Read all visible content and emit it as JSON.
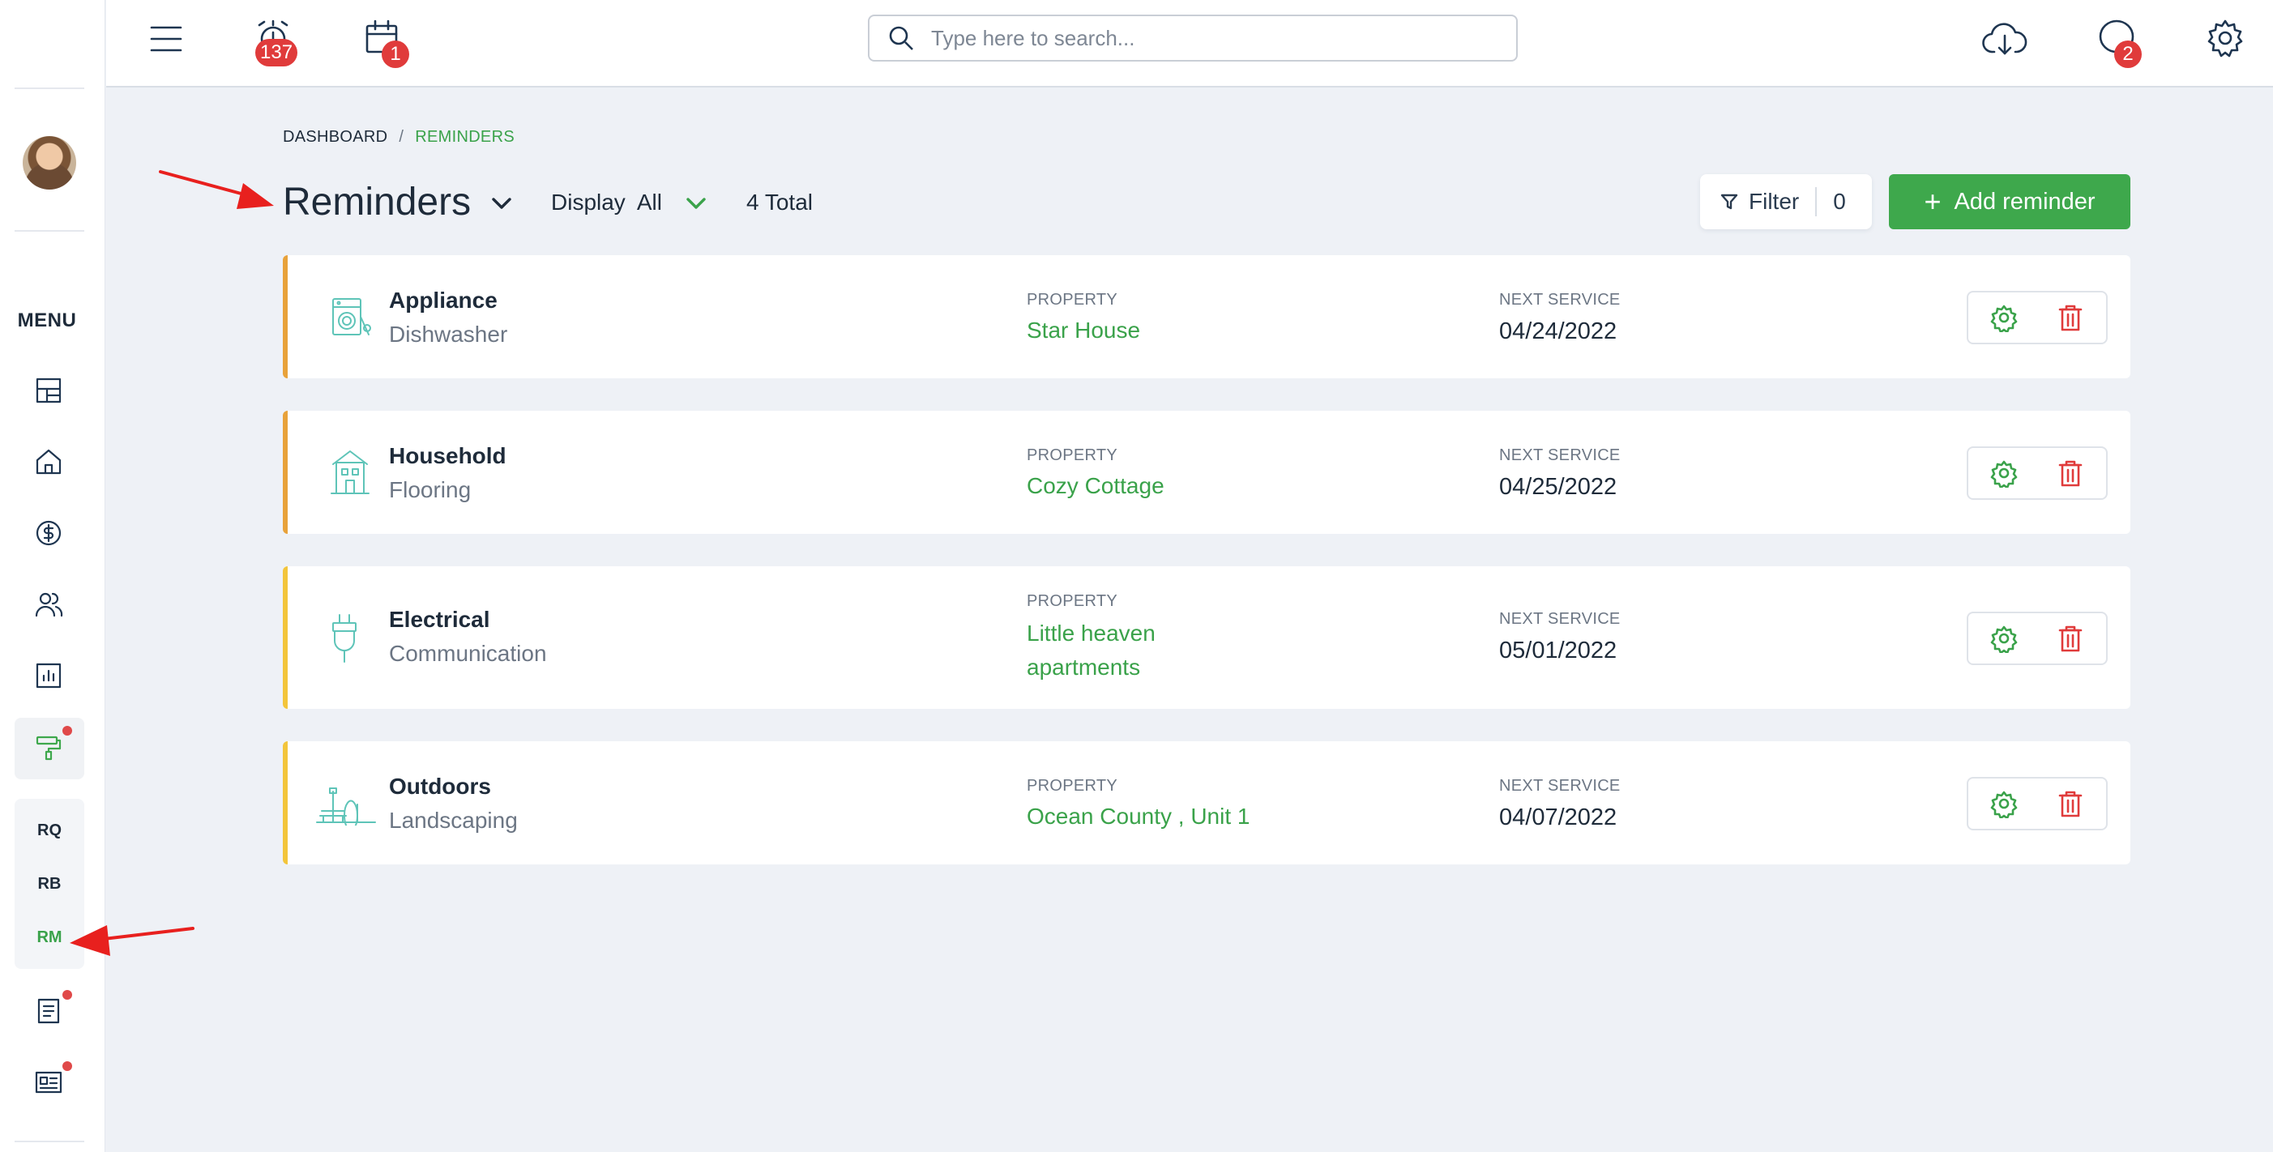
{
  "sidebar": {
    "menu_title": "MENU",
    "sub_items": [
      "RQ",
      "RB",
      "RM"
    ]
  },
  "topbar": {
    "alarm_badge": "137",
    "calendar_badge": "1",
    "chat_badge": "2",
    "search_placeholder": "Type here to search..."
  },
  "breadcrumb": {
    "root": "DASHBOARD",
    "separator": "/",
    "current": "REMINDERS"
  },
  "header": {
    "title": "Reminders",
    "display_label": "Display",
    "display_value": "All",
    "total": "4 Total",
    "filter_label": "Filter",
    "filter_count": "0",
    "add_label": "Add reminder"
  },
  "labels": {
    "property": "PROPERTY",
    "next_service": "NEXT SERVICE"
  },
  "reminders": [
    {
      "category": "Appliance",
      "subcategory": "Dishwasher",
      "property": "Star House",
      "next_service": "04/24/2022",
      "icon": "washing-machine-icon",
      "accent": "#e8a23a"
    },
    {
      "category": "Household",
      "subcategory": "Flooring",
      "property": "Cozy Cottage",
      "next_service": "04/25/2022",
      "icon": "house-icon",
      "accent": "#e8a23a"
    },
    {
      "category": "Electrical",
      "subcategory": "Communication",
      "property": "Little heaven apartments",
      "next_service": "05/01/2022",
      "icon": "plug-icon",
      "accent": "#f3c53b"
    },
    {
      "category": "Outdoors",
      "subcategory": "Landscaping",
      "property": "Ocean County , Unit 1",
      "next_service": "04/07/2022",
      "icon": "park-icon",
      "accent": "#f3c53b"
    }
  ],
  "colors": {
    "primary_green": "#3ea84c",
    "danger_red": "#e03b3b",
    "text_dark": "#1e2b3a"
  }
}
